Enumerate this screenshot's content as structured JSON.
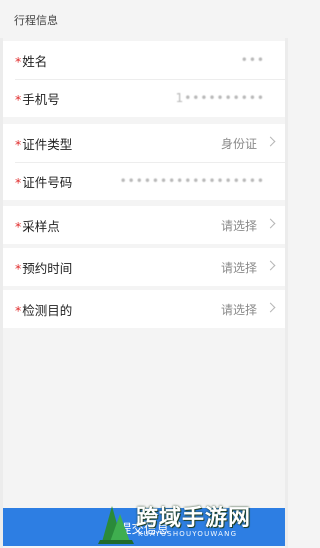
{
  "section": {
    "title": "行程信息"
  },
  "card1": {
    "rows": [
      {
        "required": "*",
        "label": "姓名",
        "value": "•••"
      },
      {
        "required": "*",
        "label": "手机号",
        "value": "1••••••••••"
      }
    ]
  },
  "card2": {
    "rows": [
      {
        "required": "*",
        "label": "证件类型",
        "value": "身份证"
      },
      {
        "required": "*",
        "label": "证件号码",
        "value": "••••••••••••••••••"
      }
    ]
  },
  "card3": {
    "required": "*",
    "label": "采样点",
    "value": "请选择"
  },
  "card4": {
    "required": "*",
    "label": "预约时间",
    "value": "请选择"
  },
  "card5": {
    "required": "*",
    "label": "检测目的",
    "value": "请选择"
  },
  "submit": {
    "label": "提交信息"
  },
  "watermark": {
    "text": "跨域手游网",
    "sub": "KUAYUSHOUYOUWANG"
  },
  "colors": {
    "accent": "#2d7ee3",
    "required": "#e02b2b",
    "background": "#f4f4f4"
  }
}
